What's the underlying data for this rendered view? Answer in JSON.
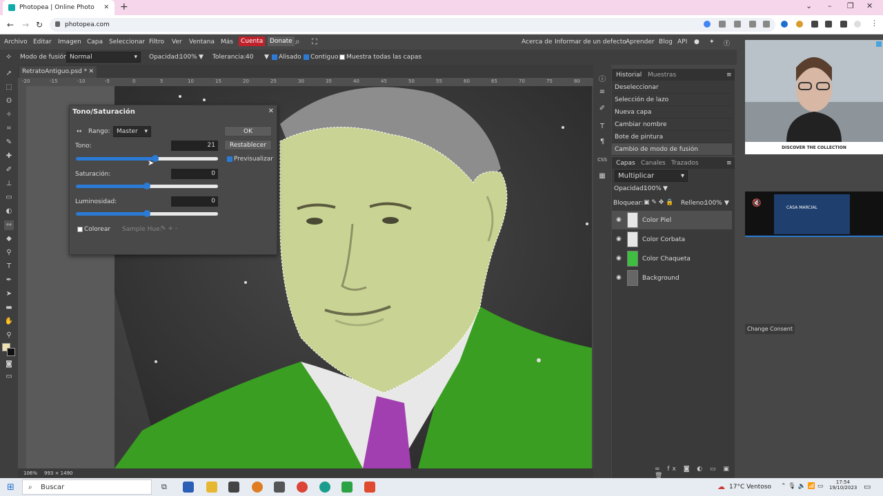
{
  "browser": {
    "tab_title": "Photopea | Online Photo Editor",
    "tab_close": "✕",
    "new_tab": "+",
    "url": "photopea.com",
    "win_min": "–",
    "win_restore": "❐",
    "win_close": "✕"
  },
  "menu": {
    "items": [
      "Archivo",
      "Editar",
      "Imagen",
      "Capa",
      "Seleccionar",
      "Filtro",
      "Ver",
      "Ventana",
      "Más"
    ],
    "cuenta": "Cuenta",
    "donate": "Donate",
    "right_links": [
      "Acerca de",
      "Informar de un defecto",
      "Aprender",
      "Blog",
      "API"
    ]
  },
  "options": {
    "blend_label": "Modo de fusión:",
    "blend_value": "Normal",
    "opacity_label": "Opacidad:",
    "opacity_value": "100%",
    "tolerance_label": "Tolerancia:",
    "tolerance_value": "40",
    "alisado": "Alisado",
    "contiguo": "Contiguo",
    "muestra": "Muestra todas las capas"
  },
  "document": {
    "tab_name": "RetratoAntiguo.psd *",
    "ruler_labels": [
      "-20",
      "-15",
      "-10",
      "-5",
      "0",
      "5",
      "10",
      "15",
      "20",
      "25",
      "30",
      "35",
      "40",
      "45",
      "50",
      "55",
      "60",
      "65",
      "70",
      "75",
      "80"
    ],
    "zoom": "106%",
    "size": "993 × 1490"
  },
  "dialog": {
    "title": "Tono/Saturación",
    "close": "✕",
    "rango_label": "Rango:",
    "rango_value": "Master",
    "tono_label": "Tono:",
    "tono_value": "21",
    "sat_label": "Saturación:",
    "sat_value": "0",
    "lum_label": "Luminosidad:",
    "lum_value": "0",
    "colorear": "Colorear",
    "sample_hue": "Sample Hue:",
    "ok": "OK",
    "restablecer": "Restablecer",
    "previsualizar": "Previsualizar",
    "tono_level": 0.56,
    "sat_level": 0.5,
    "lum_level": 0.5
  },
  "history": {
    "tabs": [
      "Historial",
      "Muestras"
    ],
    "items": [
      "Deseleccionar",
      "Selección de lazo",
      "Nueva capa",
      "Cambiar nombre",
      "Bote de pintura",
      "Cambio de modo de fusión"
    ]
  },
  "layers": {
    "tabs": [
      "Capas",
      "Canales",
      "Trazados"
    ],
    "blend": "Multiplicar",
    "opacity_label": "Opacidad:",
    "opacity_value": "100%",
    "lock_label": "Bloquear:",
    "fill_label": "Relleno:",
    "fill_value": "100%",
    "items": [
      {
        "name": "Color Piel",
        "thumb": "#e6e6e6"
      },
      {
        "name": "Color Corbata",
        "thumb": "#e6e6e6"
      },
      {
        "name": "Color Chaqueta",
        "thumb": "#3fbf3f"
      },
      {
        "name": "Background",
        "thumb": "#666666"
      }
    ]
  },
  "ads": {
    "ad1_text": "DISCOVER THE COLLECTION",
    "ad2_text": "CASA MARCIAL",
    "consent": "Change Consent"
  },
  "taskbar": {
    "search": "Buscar",
    "weather": "17°C  Ventoso",
    "time": "17:54",
    "date": "19/10/2023"
  },
  "colors": {
    "accent": "#2b7bd6",
    "cuenta": "#c0222c",
    "jacket": "#3a9e22",
    "skin": "#c9d494",
    "tie": "#a23fb0"
  }
}
